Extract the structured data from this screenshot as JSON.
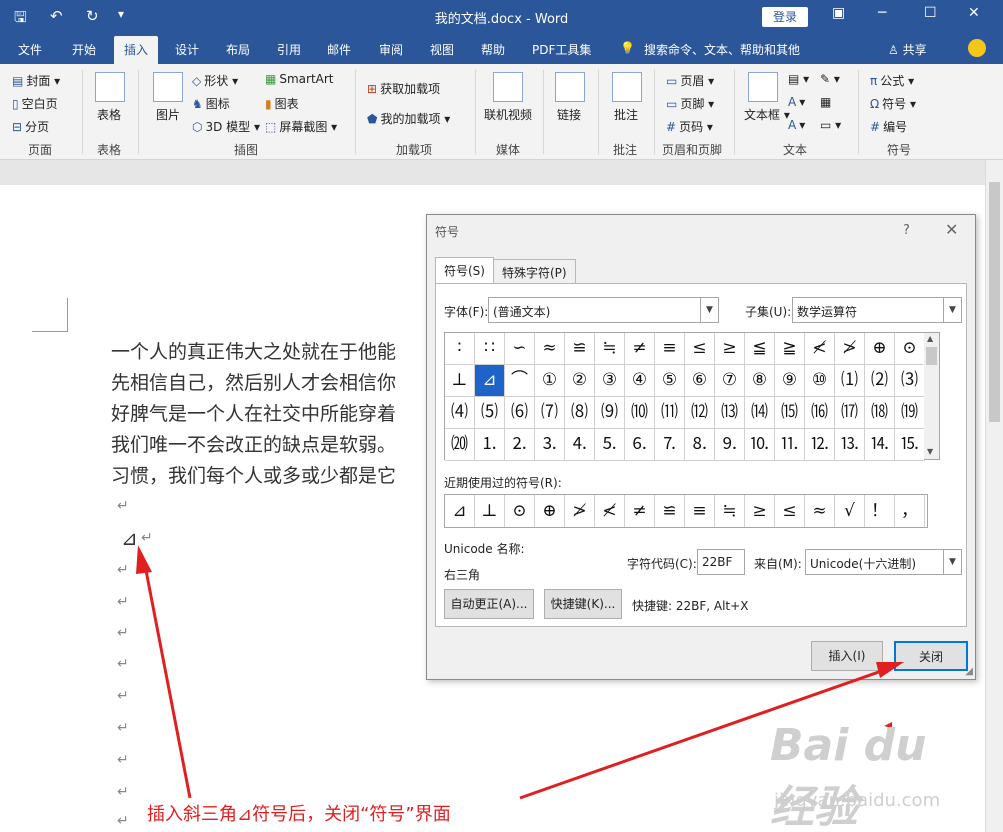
{
  "window": {
    "title": "我的文档.docx - Word",
    "login": "登录",
    "share": "共享"
  },
  "tabs": [
    "文件",
    "开始",
    "插入",
    "设计",
    "布局",
    "引用",
    "邮件",
    "审阅",
    "视图",
    "帮助",
    "PDF工具集"
  ],
  "active_tab": "插入",
  "search_hint": "搜索命令、文本、帮助和其他",
  "ribbon": {
    "pages": {
      "cover": "封面",
      "blank": "空白页",
      "break": "分页",
      "label": "页面"
    },
    "tables": {
      "table": "表格",
      "label": "表格"
    },
    "illustrations": {
      "pictures": "图片",
      "shapes": "形状",
      "icons": "图标",
      "models3d": "3D 模型",
      "smartart": "SmartArt",
      "chart": "图表",
      "screenshot": "屏幕截图",
      "label": "插图"
    },
    "addins": {
      "get": "获取加载项",
      "mine": "我的加载项",
      "label": "加载项"
    },
    "media": {
      "video": "联机视频",
      "label": "媒体"
    },
    "links": {
      "link": "链接"
    },
    "comments": {
      "comment": "批注",
      "label": "批注"
    },
    "header_footer": {
      "header": "页眉",
      "footer": "页脚",
      "page_number": "页码",
      "label": "页眉和页脚"
    },
    "text": {
      "textbox": "文本框",
      "label": "文本"
    },
    "symbols": {
      "equation": "公式",
      "symbol": "符号",
      "number": "编号",
      "label": "符号"
    }
  },
  "document": {
    "lines": [
      "一个人的真正伟大之处就在于他能",
      "先相信自己，然后别人才会相信你",
      "好脾气是一个人在社交中所能穿着",
      "我们唯一不会改正的缺点是软弱。",
      "习惯，我们每个人或多或少都是它"
    ],
    "para_mark": "↵",
    "inserted_symbol": "⊿"
  },
  "dialog": {
    "title": "符号",
    "help": "?",
    "close_x": "✕",
    "tab_symbols": "符号(S)",
    "tab_special": "特殊字符(P)",
    "font_label": "字体(F):",
    "font_value": "(普通文本)",
    "subset_label": "子集(U):",
    "subset_value": "数学运算符",
    "symbol_rows": [
      [
        "∶",
        "∷",
        "∽",
        "≈",
        "≌",
        "≒",
        "≠",
        "≡",
        "≤",
        "≥",
        "≦",
        "≧",
        "≮",
        "≯",
        "⊕",
        "⊙"
      ],
      [
        "⊥",
        "⊿",
        "⌒",
        "①",
        "②",
        "③",
        "④",
        "⑤",
        "⑥",
        "⑦",
        "⑧",
        "⑨",
        "⑩",
        "⑴",
        "⑵",
        "⑶"
      ],
      [
        "⑷",
        "⑸",
        "⑹",
        "⑺",
        "⑻",
        "⑼",
        "⑽",
        "⑾",
        "⑿",
        "⒀",
        "⒁",
        "⒂",
        "⒃",
        "⒄",
        "⒅",
        "⒆"
      ],
      [
        "⒇",
        "⒈",
        "⒉",
        "⒊",
        "⒋",
        "⒌",
        "⒍",
        "⒎",
        "⒏",
        "⒐",
        "⒑",
        "⒒",
        "⒓",
        "⒔",
        "⒕",
        "⒖"
      ]
    ],
    "selected_symbol": "⊿",
    "recent_label": "近期使用过的符号(R):",
    "recent_symbols": [
      "⊿",
      "⊥",
      "⊙",
      "⊕",
      "≯",
      "≮",
      "≠",
      "≌",
      "≡",
      "≒",
      "≥",
      "≤",
      "≈",
      "√",
      "！",
      "，"
    ],
    "unicode_name_label": "Unicode 名称:",
    "unicode_name": "右三角",
    "char_code_label": "字符代码(C):",
    "char_code": "22BF",
    "from_label": "来自(M):",
    "from_value": "Unicode(十六进制)",
    "autocorrect": "自动更正(A)...",
    "shortcut_key": "快捷键(K)...",
    "shortcut_info": "快捷键: 22BF, Alt+X",
    "insert": "插入(I)",
    "close": "关闭"
  },
  "annotation": {
    "text": "插入斜三角⊿符号后，关闭“符号”界面",
    "color": "#e02020"
  },
  "watermark": {
    "brand": "Bai du 经验",
    "url": "jingyan.baidu.com"
  }
}
